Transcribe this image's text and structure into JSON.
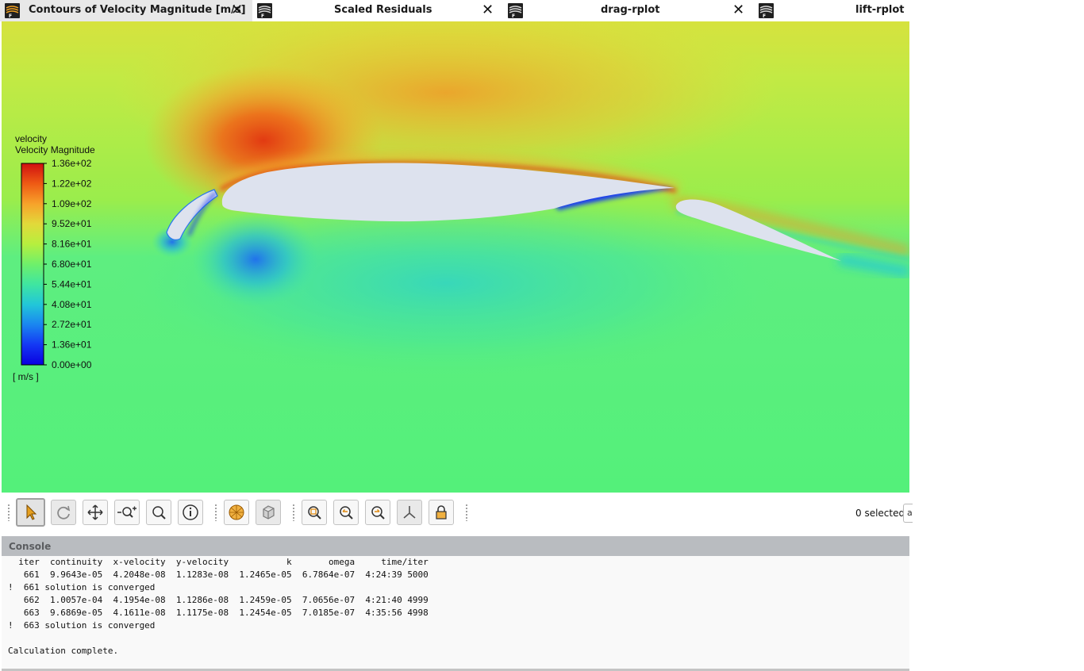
{
  "tabs": [
    {
      "label": "Contours of Velocity Magnitude [m/s]",
      "close": "✕",
      "active": true
    },
    {
      "label": "Scaled Residuals",
      "close": "✕",
      "active": false
    },
    {
      "label": "drag-rplot",
      "close": "✕",
      "active": false
    },
    {
      "label": "lift-rplot",
      "close": "",
      "active": false
    }
  ],
  "legend": {
    "title_line1": "velocity",
    "title_line2": "Velocity Magnitude",
    "ticks": [
      "1.36e+02",
      "1.22e+02",
      "1.09e+02",
      "9.52e+01",
      "8.16e+01",
      "6.80e+01",
      "5.44e+01",
      "4.08e+01",
      "2.72e+01",
      "1.36e+01",
      "0.00e+00"
    ],
    "unit": "[ m/s ]",
    "colormap": [
      "#d01010",
      "#ee5a14",
      "#f7a22a",
      "#e2d93a",
      "#b6ef3e",
      "#6ff06a",
      "#3fe6a0",
      "#22c7d8",
      "#1a86f0",
      "#1438f4",
      "#0a00e0"
    ]
  },
  "colors": {
    "freestream": "#b9ec4a",
    "wake": "#55ef78",
    "airfoil": "#dde2ee"
  },
  "toolbar": {
    "buttons": [
      {
        "name": "select-tool-button",
        "icon": "pointer-icon"
      },
      {
        "name": "rotate-view-button",
        "icon": "rotate-icon"
      },
      {
        "name": "pan-button",
        "icon": "pan-icon"
      },
      {
        "name": "zoom-in-out-button",
        "icon": "zoom-in-out-icon"
      },
      {
        "name": "zoom-to-area-button",
        "icon": "zoom-area-icon"
      },
      {
        "name": "probe-button",
        "icon": "info-icon"
      },
      {
        "name": "fit-to-window-button",
        "icon": "sphere-icon"
      },
      {
        "name": "isometric-view-button",
        "icon": "cube-icon"
      },
      {
        "name": "zoom-fit-button",
        "icon": "zoom-fit-icon"
      },
      {
        "name": "zoom-previous-button",
        "icon": "zoom-previous-icon"
      },
      {
        "name": "zoom-next-button",
        "icon": "zoom-next-icon"
      },
      {
        "name": "axes-button",
        "icon": "axes-icon"
      },
      {
        "name": "lock-view-button",
        "icon": "lock-icon"
      }
    ],
    "selected_text": "0 selected",
    "selection_box_text": "a"
  },
  "console": {
    "title": "Console",
    "lines": [
      "  iter  continuity  x-velocity  y-velocity           k       omega     time/iter",
      "   661  9.9643e-05  4.2048e-08  1.1283e-08  1.2465e-05  6.7864e-07  4:24:39 5000",
      "!  661 solution is converged",
      "   662  1.0057e-04  4.1954e-08  1.1286e-08  1.2459e-05  7.0656e-07  4:21:40 4999",
      "   663  9.6869e-05  4.1611e-08  1.1175e-08  1.2454e-05  7.0185e-07  4:35:56 4998",
      "!  663 solution is converged",
      "",
      "Calculation complete."
    ]
  }
}
